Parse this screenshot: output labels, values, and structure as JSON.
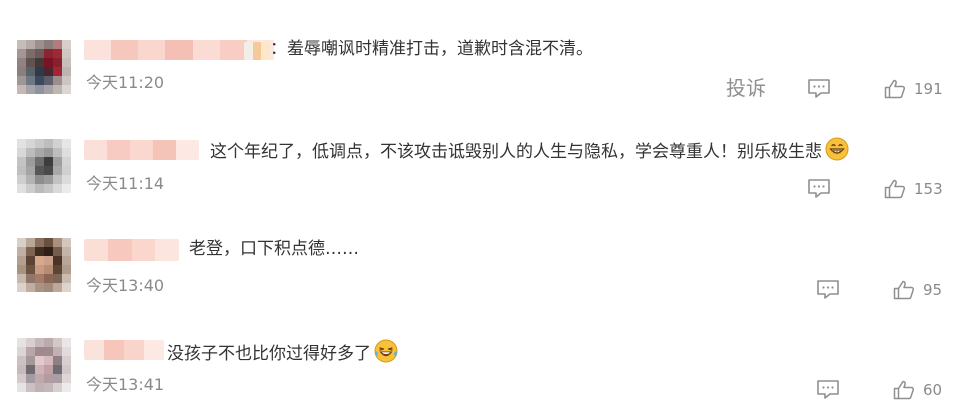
{
  "comments": [
    {
      "text_prefix": "：",
      "text": "羞辱嘲讽时精准打击，道歉时含混不清。",
      "time": "今天11:20",
      "report_label": "投诉",
      "likes": "191",
      "emoji": ""
    },
    {
      "text_prefix": "",
      "text": "这个年纪了，低调点，不该攻击诋毁别人的人生与隐私，学会尊重人！别乐极生悲",
      "time": "今天11:14",
      "report_label": "",
      "likes": "153",
      "emoji": "grinning-face"
    },
    {
      "text_prefix": "",
      "text": "老登，口下积点德……",
      "time": "今天13:40",
      "report_label": "",
      "likes": "95",
      "emoji": ""
    },
    {
      "text_prefix": "",
      "text": "没孩子不也比你过得好多了",
      "time": "今天13:41",
      "report_label": "",
      "likes": "60",
      "emoji": "laughing-tears-face"
    }
  ],
  "colors": {
    "text": "#333333",
    "meta": "#8a8a8a",
    "username_blur": "#f6c9be",
    "emoji_yellow": "#f7c23a"
  }
}
